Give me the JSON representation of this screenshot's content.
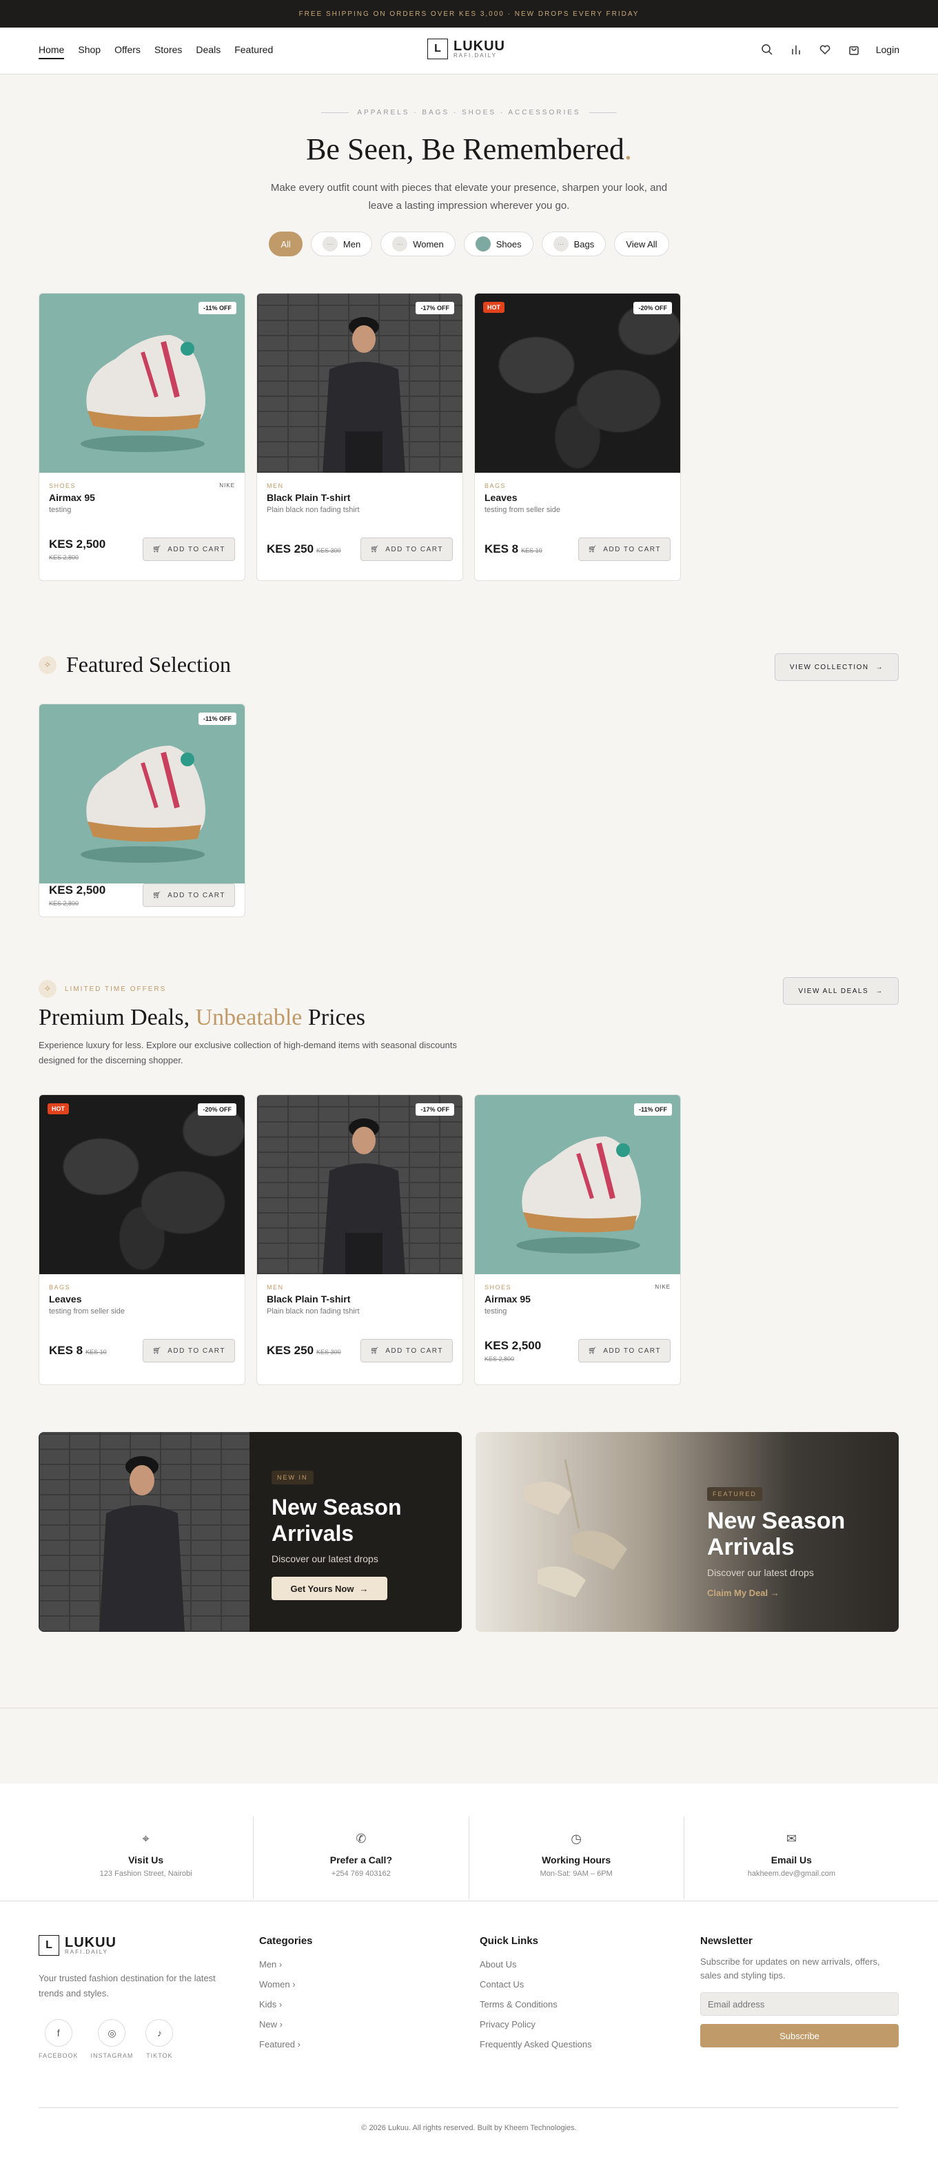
{
  "topbar": {
    "text": "FREE SHIPPING ON ORDERS OVER KES 3,000 · NEW DROPS EVERY FRIDAY"
  },
  "nav": {
    "links": [
      "Home",
      "Shop",
      "Offers",
      "Stores",
      "Deals",
      "Featured"
    ],
    "login": "Login"
  },
  "logo": {
    "mark": "L",
    "name": "LUKUU",
    "tag": "RAFI.DAILY"
  },
  "hero": {
    "eyebrow": "APPARELS · BAGS · SHOES · ACCESSORIES",
    "title": "Be Seen, Be Remembered",
    "dot": ".",
    "subtitle": "Make every outfit count with pieces that elevate your presence, sharpen your look, and leave a lasting impression wherever you go."
  },
  "chips": [
    "All",
    "Men",
    "Women",
    "Shoes",
    "Bags",
    "View All"
  ],
  "products": [
    {
      "badge": "-11% OFF",
      "hot": "",
      "cat": "SHOES",
      "brand": "NIKE",
      "name": "Airmax 95",
      "desc": "testing",
      "price": "KES 2,500",
      "old": "KES 2,800"
    },
    {
      "badge": "-17% OFF",
      "hot": "",
      "cat": "MEN",
      "brand": "",
      "name": "Black Plain T-shirt",
      "desc": "Plain black non fading tshirt",
      "price": "KES 250",
      "old": "KES 300"
    },
    {
      "badge": "-20% OFF",
      "hot": "HOT",
      "cat": "BAGS",
      "brand": "",
      "name": "Leaves",
      "desc": "testing from seller side",
      "price": "KES 8",
      "old": "KES 10"
    }
  ],
  "add_to_cart": "ADD TO CART",
  "featured": {
    "title": "Featured Selection",
    "button": "VIEW COLLECTION",
    "card": {
      "badge": "-11% OFF",
      "price": "KES 2,500",
      "old": "KES 2,800"
    }
  },
  "deals": {
    "eyebrow": "LIMITED TIME OFFERS",
    "title_a": "Premium Deals,",
    "title_b": "Unbeatable",
    "title_c": "Prices",
    "desc": "Experience luxury for less. Explore our exclusive collection of high-demand items with seasonal discounts designed for the discerning shopper.",
    "button": "VIEW ALL DEALS",
    "items": [
      {
        "badge": "-20% OFF",
        "hot": "HOT",
        "cat": "BAGS",
        "brand": "",
        "name": "Leaves",
        "desc": "testing from seller side",
        "price": "KES 8",
        "old": "KES 10"
      },
      {
        "badge": "-17% OFF",
        "hot": "",
        "cat": "MEN",
        "brand": "",
        "name": "Black Plain T-shirt",
        "desc": "Plain black non fading tshirt",
        "price": "KES 250",
        "old": "KES 300"
      },
      {
        "badge": "-11% OFF",
        "hot": "",
        "cat": "SHOES",
        "brand": "NIKE",
        "name": "Airmax 95",
        "desc": "testing",
        "price": "KES 2,500",
        "old": "KES 2,800"
      }
    ]
  },
  "banners": [
    {
      "tag": "NEW IN",
      "title": "New Season Arrivals",
      "sub": "Discover our latest drops",
      "cta": "Get Yours Now"
    },
    {
      "tag": "FEATURED",
      "title": "New Season Arrivals",
      "sub": "Discover our latest drops",
      "cta": "Claim My Deal"
    }
  ],
  "contact": [
    {
      "title": "Visit Us",
      "sub": "123 Fashion Street, Nairobi"
    },
    {
      "title": "Prefer a Call?",
      "sub": "+254 769 403162"
    },
    {
      "title": "Working Hours",
      "sub": "Mon-Sat: 9AM – 6PM"
    },
    {
      "title": "Email Us",
      "sub": "hakheem.dev@gmail.com"
    }
  ],
  "footer": {
    "about": "Your trusted fashion destination for the latest trends and styles.",
    "socials": [
      "FACEBOOK",
      "INSTAGRAM",
      "TIKTOK"
    ],
    "categories_title": "Categories",
    "categories": [
      "Men",
      "Women",
      "Kids",
      "New",
      "Featured"
    ],
    "links_title": "Quick Links",
    "links": [
      "About Us",
      "Contact Us",
      "Terms & Conditions",
      "Privacy Policy",
      "Frequently Asked Questions"
    ],
    "news_title": "Newsletter",
    "news_desc": "Subscribe for updates on new arrivals, offers, sales and styling tips.",
    "email_placeholder": "Email address",
    "subscribe": "Subscribe",
    "copyright": "© 2026 Lukuu. All rights reserved. Built by Kheem Technologies."
  },
  "colors": {
    "accent": "#c09a68",
    "dark": "#201e1b",
    "hot": "#e2431d"
  }
}
